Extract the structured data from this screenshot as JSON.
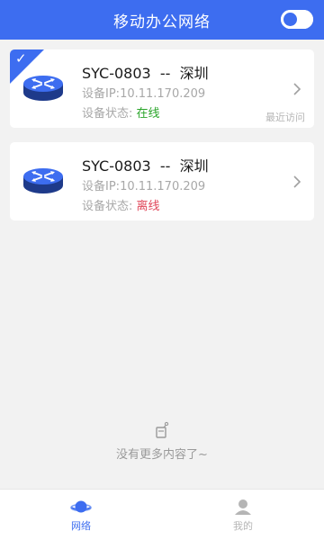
{
  "header": {
    "title": "移动办公网络",
    "toggle_state": "off"
  },
  "devices": [
    {
      "name": "SYC-0803  --  深圳",
      "ip_label": "设备IP:",
      "ip": "10.11.170.209",
      "status_label": "设备状态:",
      "status": "在线",
      "recent_tag": "最近访问",
      "selected": true,
      "icon": "router-icon"
    },
    {
      "name": "SYC-0803  --  深圳",
      "ip_label": "设备IP:",
      "ip": "10.11.170.209",
      "status_label": "设备状态:",
      "status": "离线",
      "selected": false,
      "icon": "router-icon"
    }
  ],
  "empty": {
    "text": "没有更多内容了~",
    "icon": "empty-box-icon"
  },
  "tabbar": {
    "tabs": [
      {
        "label": "网络",
        "icon": "planet-icon",
        "active": true
      },
      {
        "label": "我的",
        "icon": "user-icon",
        "active": false
      }
    ]
  },
  "colors": {
    "accent": "#3d6df0",
    "online": "#2aa52a",
    "offline": "#e0475a"
  }
}
